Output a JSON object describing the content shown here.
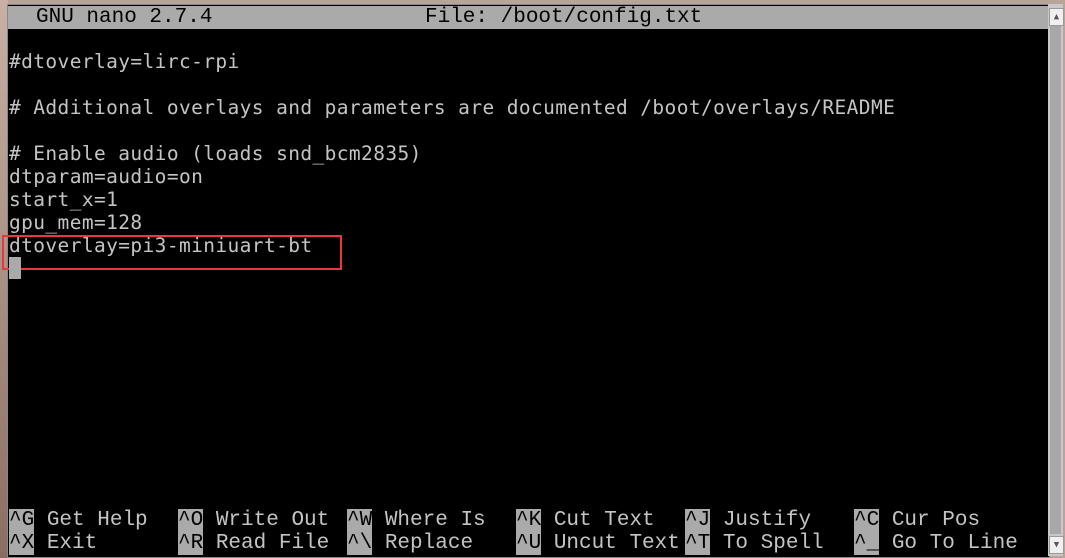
{
  "titlebar": {
    "app": "GNU nano 2.7.4",
    "file": "File: /boot/config.txt"
  },
  "lines": [
    "",
    "#dtoverlay=lirc-rpi",
    "",
    "# Additional overlays and parameters are documented /boot/overlays/README",
    "",
    "# Enable audio (loads snd_bcm2835)",
    "dtparam=audio=on",
    "start_x=1",
    "gpu_mem=128",
    "dtoverlay=pi3-miniuart-bt"
  ],
  "highlight_color": "#e8373d",
  "shortcuts": [
    [
      {
        "key": "^G",
        "label": "Get Help"
      },
      {
        "key": "^O",
        "label": "Write Out"
      },
      {
        "key": "^W",
        "label": "Where Is"
      },
      {
        "key": "^K",
        "label": "Cut Text"
      },
      {
        "key": "^J",
        "label": "Justify"
      },
      {
        "key": "^C",
        "label": "Cur Pos"
      }
    ],
    [
      {
        "key": "^X",
        "label": "Exit"
      },
      {
        "key": "^R",
        "label": "Read File"
      },
      {
        "key": "^\\",
        "label": "Replace"
      },
      {
        "key": "^U",
        "label": "Uncut Text"
      },
      {
        "key": "^T",
        "label": "To Spell"
      },
      {
        "key": "^_",
        "label": "Go To Line"
      }
    ]
  ]
}
